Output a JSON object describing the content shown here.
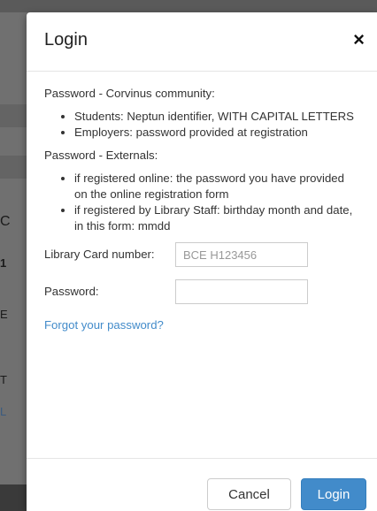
{
  "background": {
    "fragments": [
      "C",
      "1",
      "E",
      "T",
      "L"
    ]
  },
  "modal": {
    "title": "Login",
    "close_icon": "×",
    "password_corvinus_heading": "Password - Corvinus community:",
    "corvinus_items": [
      "Students: Neptun identifier, WITH CAPITAL LETTERS",
      "Employers: password provided at registration"
    ],
    "password_externals_heading": "Password - Externals:",
    "externals_items": [
      "if registered online: the password you have provided on the online registration form",
      "if registered by Library Staff: birthday month and date, in this form: mmdd"
    ],
    "card_label": "Library Card number:",
    "card_placeholder": "BCE H123456",
    "card_value": "",
    "password_label": "Password:",
    "password_value": "",
    "forgot_link": "Forgot your password?",
    "cancel_label": "Cancel",
    "login_label": "Login"
  },
  "colors": {
    "primary": "#428bca",
    "link": "#428bca",
    "backdrop": "#707070"
  }
}
